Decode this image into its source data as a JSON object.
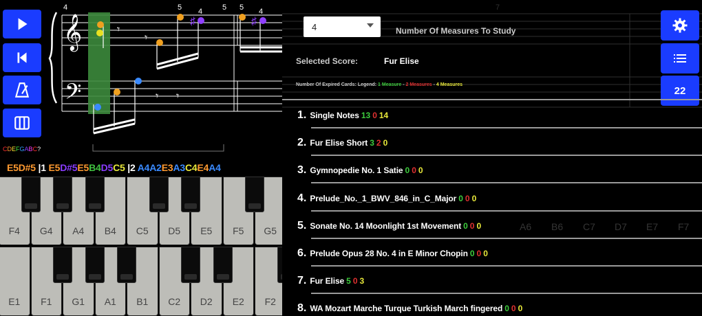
{
  "left": {
    "buttons": [
      "play",
      "skip-back",
      "metronome",
      "keyboard"
    ],
    "note_colors_text": "CDEFGABC?",
    "note_colors": [
      "#ff3030",
      "#ff9a30",
      "#ffe830",
      "#40e040",
      "#30a0ff",
      "#8040ff",
      "#ff40ff",
      "#ff3030",
      "#ffffff"
    ],
    "score": {
      "measure_number_left": "4",
      "finger_numbers": [
        "5",
        "4",
        "5",
        "5",
        "4"
      ]
    },
    "sequence": [
      {
        "t": "E5",
        "c": "#ff9a30"
      },
      {
        "t": "D#5",
        "c": "#ff9a30"
      },
      {
        "t": " |1 ",
        "c": "#ffffff"
      },
      {
        "t": "E5",
        "c": "#ff9a30"
      },
      {
        "t": "D#5",
        "c": "#8a3cff"
      },
      {
        "t": "E5",
        "c": "#ff9a30"
      },
      {
        "t": "B4",
        "c": "#40c040"
      },
      {
        "t": "D5",
        "c": "#8a3cff"
      },
      {
        "t": "C5",
        "c": "#e8e83a"
      },
      {
        "t": " |2 ",
        "c": "#ffffff"
      },
      {
        "t": "A4",
        "c": "#3a8aff"
      },
      {
        "t": "A2",
        "c": "#3a8aff"
      },
      {
        "t": "E3",
        "c": "#ff9a30"
      },
      {
        "t": "A3",
        "c": "#3a8aff"
      },
      {
        "t": "C4",
        "c": "#e8e83a"
      },
      {
        "t": "E4",
        "c": "#ff9a30"
      },
      {
        "t": "A4",
        "c": "#3a8aff"
      }
    ],
    "keys_upper": [
      "F4",
      "G4",
      "A4",
      "B4",
      "C5",
      "D5",
      "E5",
      "F5",
      "G5"
    ],
    "keys_lower": [
      "E1",
      "F1",
      "G1",
      "A1",
      "B1",
      "C2",
      "D2",
      "E2",
      "F2"
    ]
  },
  "right": {
    "measures_value": "4",
    "measures_label": "Number Of Measures To Study",
    "selected_label": "Selected Score:",
    "selected_value": "Fur Elise",
    "legend": [
      {
        "t": "Number Of Expired Cards: Legend: ",
        "c": "#cccccc"
      },
      {
        "t": "1 Measure",
        "c": "#3dcc3d"
      },
      {
        "t": " - ",
        "c": "#cccccc"
      },
      {
        "t": "2 Measures",
        "c": "#e03030"
      },
      {
        "t": " - ",
        "c": "#cccccc"
      },
      {
        "t": "4 Measures",
        "c": "#e8e83a"
      }
    ],
    "count_badge": "22",
    "ghost_keys": [
      "A6",
      "B6",
      "C7",
      "D7",
      "E7",
      "F7"
    ],
    "ghost_measure": "7",
    "scores": [
      {
        "num": "1.",
        "title": "Single Notes",
        "g": "13",
        "r": "0",
        "y": "14"
      },
      {
        "num": "2.",
        "title": "Fur Elise Short",
        "g": "3",
        "r": "2",
        "y": "0"
      },
      {
        "num": "3.",
        "title": "Gymnopedie No. 1 Satie",
        "g": "0",
        "r": "0",
        "y": "0"
      },
      {
        "num": "4.",
        "title": "Prelude_No._1_BWV_846_in_C_Major",
        "g": "0",
        "r": "0",
        "y": "0"
      },
      {
        "num": "5.",
        "title": "Sonate No. 14 Moonlight 1st Movement",
        "g": "0",
        "r": "0",
        "y": "0"
      },
      {
        "num": "6.",
        "title": "Prelude Opus 28 No. 4 in E Minor Chopin",
        "g": "0",
        "r": "0",
        "y": "0"
      },
      {
        "num": "7.",
        "title": "Fur Elise",
        "g": "5",
        "r": "0",
        "y": "3"
      },
      {
        "num": "8.",
        "title": "WA Mozart Marche Turque Turkish March fingered",
        "g": "0",
        "r": "0",
        "y": "0"
      }
    ]
  }
}
